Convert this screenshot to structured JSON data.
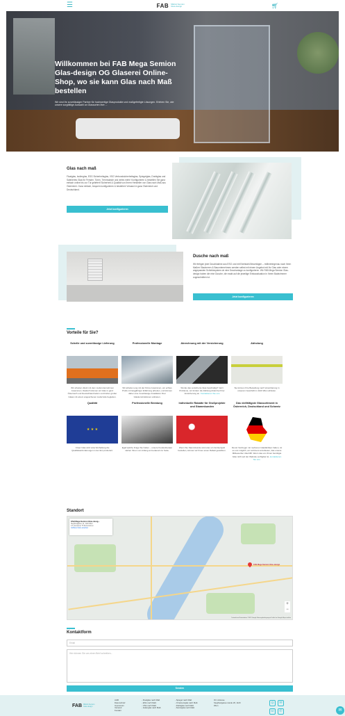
{
  "header": {
    "logo": "FAB",
    "logo_sub": "MEGA Semion Glas-design",
    "menu_icon": "hamburger-icon",
    "cart_icon": "cart-icon"
  },
  "hero": {
    "title": "Willkommen bei FAB Mega Semion Glas-design OG Glaserei Online-Shop, wo sie kann Glas nach Maß bestellen",
    "subtitle": "Wir sind Ihr zuverlässiger Partner für hochwertige Glasprodukte und maßgefertigte Lösungen. Erleben Sie, wie unsere sorgfältige Auswahl an Glassorten Ihre ..."
  },
  "glas": {
    "title": "Glas nach maß",
    "text": "Floatglas, Isolierglas, ESG Sicherheitsglas, VSG Verbundsicherheitsglas, Spiegelglas, Drahtglas und Satiniertes Glas für Fenster, Türen, Trennwände und vieles mehr! Konfigurieren & bestellen Sie ganz einfach online bis zur Tür geliefert! Sicherheit & Qualität von Ihrem Hersteller von Glas nach Maß aus Österreich. Ganz einfach, bequem konfigurieren & bestellen! Versand in ganz Österreich und Deutschland.",
    "button": "Jetzt konfigurieren"
  },
  "dusche": {
    "title": "Dusche nach maß",
    "text": "Wir fertigen jede Duschkabine aus ESG und mit Edelstahl-Beschlägen – millimetergenau nach Ihren Maßen! Bauherren & Bauunternehmen werden selbst mit einem Angebot mit Ihr Glas oder einem angepassten Schiebesystem ob eine Duschanlage zu konfigurieren. Wir FAB Mega Semion Glas-design haben die eine Dusche, die exakt auf die jeweilige Einbausituation in Ihrem Badezimmer zugeschnitten ist.",
    "button": "Jetzt konfigurieren"
  },
  "vorteile": {
    "title": "Vorteile für Sie?",
    "items": [
      {
        "head": "Schelle und zuverlässige Lieferung",
        "text": "Wir arbeiten direkt mit dem Lieferunternehmen zusammen. Dadurch können wir Glas in ganz Österreich und Deutschland liefern und bisher großer Glaas mit einem angeschenen Lieferzeile begleiten.",
        "link": ""
      },
      {
        "head": "Professionelle Montage",
        "text": "Wir arbeiten eng mit der Firma zusammen, ein echtes Profis mit langjähriger Erfahrung arbeiten, und können daher eine zuverlässige Installation Ihrer Glaskonstruktionen anbieten.",
        "link": ""
      },
      {
        "head": "Abrechnung mit der Versicherung",
        "text": "Wurde das versicherte Glas beschädigt? Jetzt Probleme, wir fordern die Zahlung direkt bei Ihrer Versicherung an.",
        "link": "Kontaktieren Sie uns"
      },
      {
        "head": "Abholung",
        "text": "Sie können Ihre Bestellung nach Vereinbarung in unserem Geschäft im 1120 Wien abholen.",
        "link": ""
      },
      {
        "head": "Qualität",
        "text": "Unser Glas wird unter Einhaltung die Qualitätsanforderungen in der EU produziert.",
        "link": ""
      },
      {
        "head": "Professionelle Beratung",
        "text": "Egal welche Frage Sie haben – unsere Kundenberater stehen Ihnen von Anfang an beratend zur Seite.",
        "link": ""
      },
      {
        "head": "Individuelle Rabatte für Großprojekte und Stammkunden",
        "text": "Wenn Sie Stammkunde sind oder ein Großprojekt bestellen, können wir Ihnen einen Rabatt gewähren.",
        "link": ""
      },
      {
        "head": "Das vielfältigste Glassortiment in Österreich, Deutschland und Schweiz",
        "text": "Da wir Vertrieger mit mehreren Glasfabriken haben, ist es uns möglich, ein sortiment anzubieten, das unsere Mitbewerber übertrifft. Wenn das von Ihnen benötigte Glas nicht auf der Website verfügbar ist,",
        "link": "kontaktieren Sie uns."
      }
    ]
  },
  "standort": {
    "title": "Standort",
    "card_name": "FAB Mega Semion Glas-desig...",
    "card_addr": "Siegfriedgasse 12, 1120 Wien",
    "card_rating": "4.6 ★★★★★ 75 Rezensionen",
    "card_link": "Größere Karte ansehen",
    "map_pin_label": "FAB Mega Semion Glas-design",
    "zoom_in": "+",
    "zoom_out": "−",
    "map_footer": "Tastenkürzel  Kartendaten ©2023 Google  Nutzungsbedingungen  Fehler bei Google Maps melden"
  },
  "kontakt": {
    "title": "Kontaktform",
    "email_placeholder": "Email",
    "message_placeholder": "Hier können Sie uns einen Brief schreiben...",
    "send": "Senden"
  },
  "footer": {
    "logo": "FAB",
    "logo_sub": "MEGA Semion Glas-design",
    "col1": [
      "AGB",
      "Datenschutz",
      "Impressum",
      "Versand",
      "Kontakt"
    ],
    "col2": [
      "- Floatglas nach Maß",
      "- ESG nach Maß",
      "- VSG nach Maß",
      "- Isolierglas nach Maß"
    ],
    "col3": [
      "- Spiegel nach Maß",
      "- Ornamentglas nach Maß",
      "- Drahtglas nach Maß",
      "- Kaminglas nach Maß"
    ],
    "col4": [
      "Ort: Adresse",
      "Siegfriedgasse Lände 26, 1120",
      "Wien"
    ],
    "icons": [
      "instagram-icon",
      "mail-icon",
      "phone-icon",
      "whatsapp-icon"
    ]
  },
  "colors": {
    "accent": "#39bfd0",
    "footer_bg": "#e2f1f2"
  }
}
